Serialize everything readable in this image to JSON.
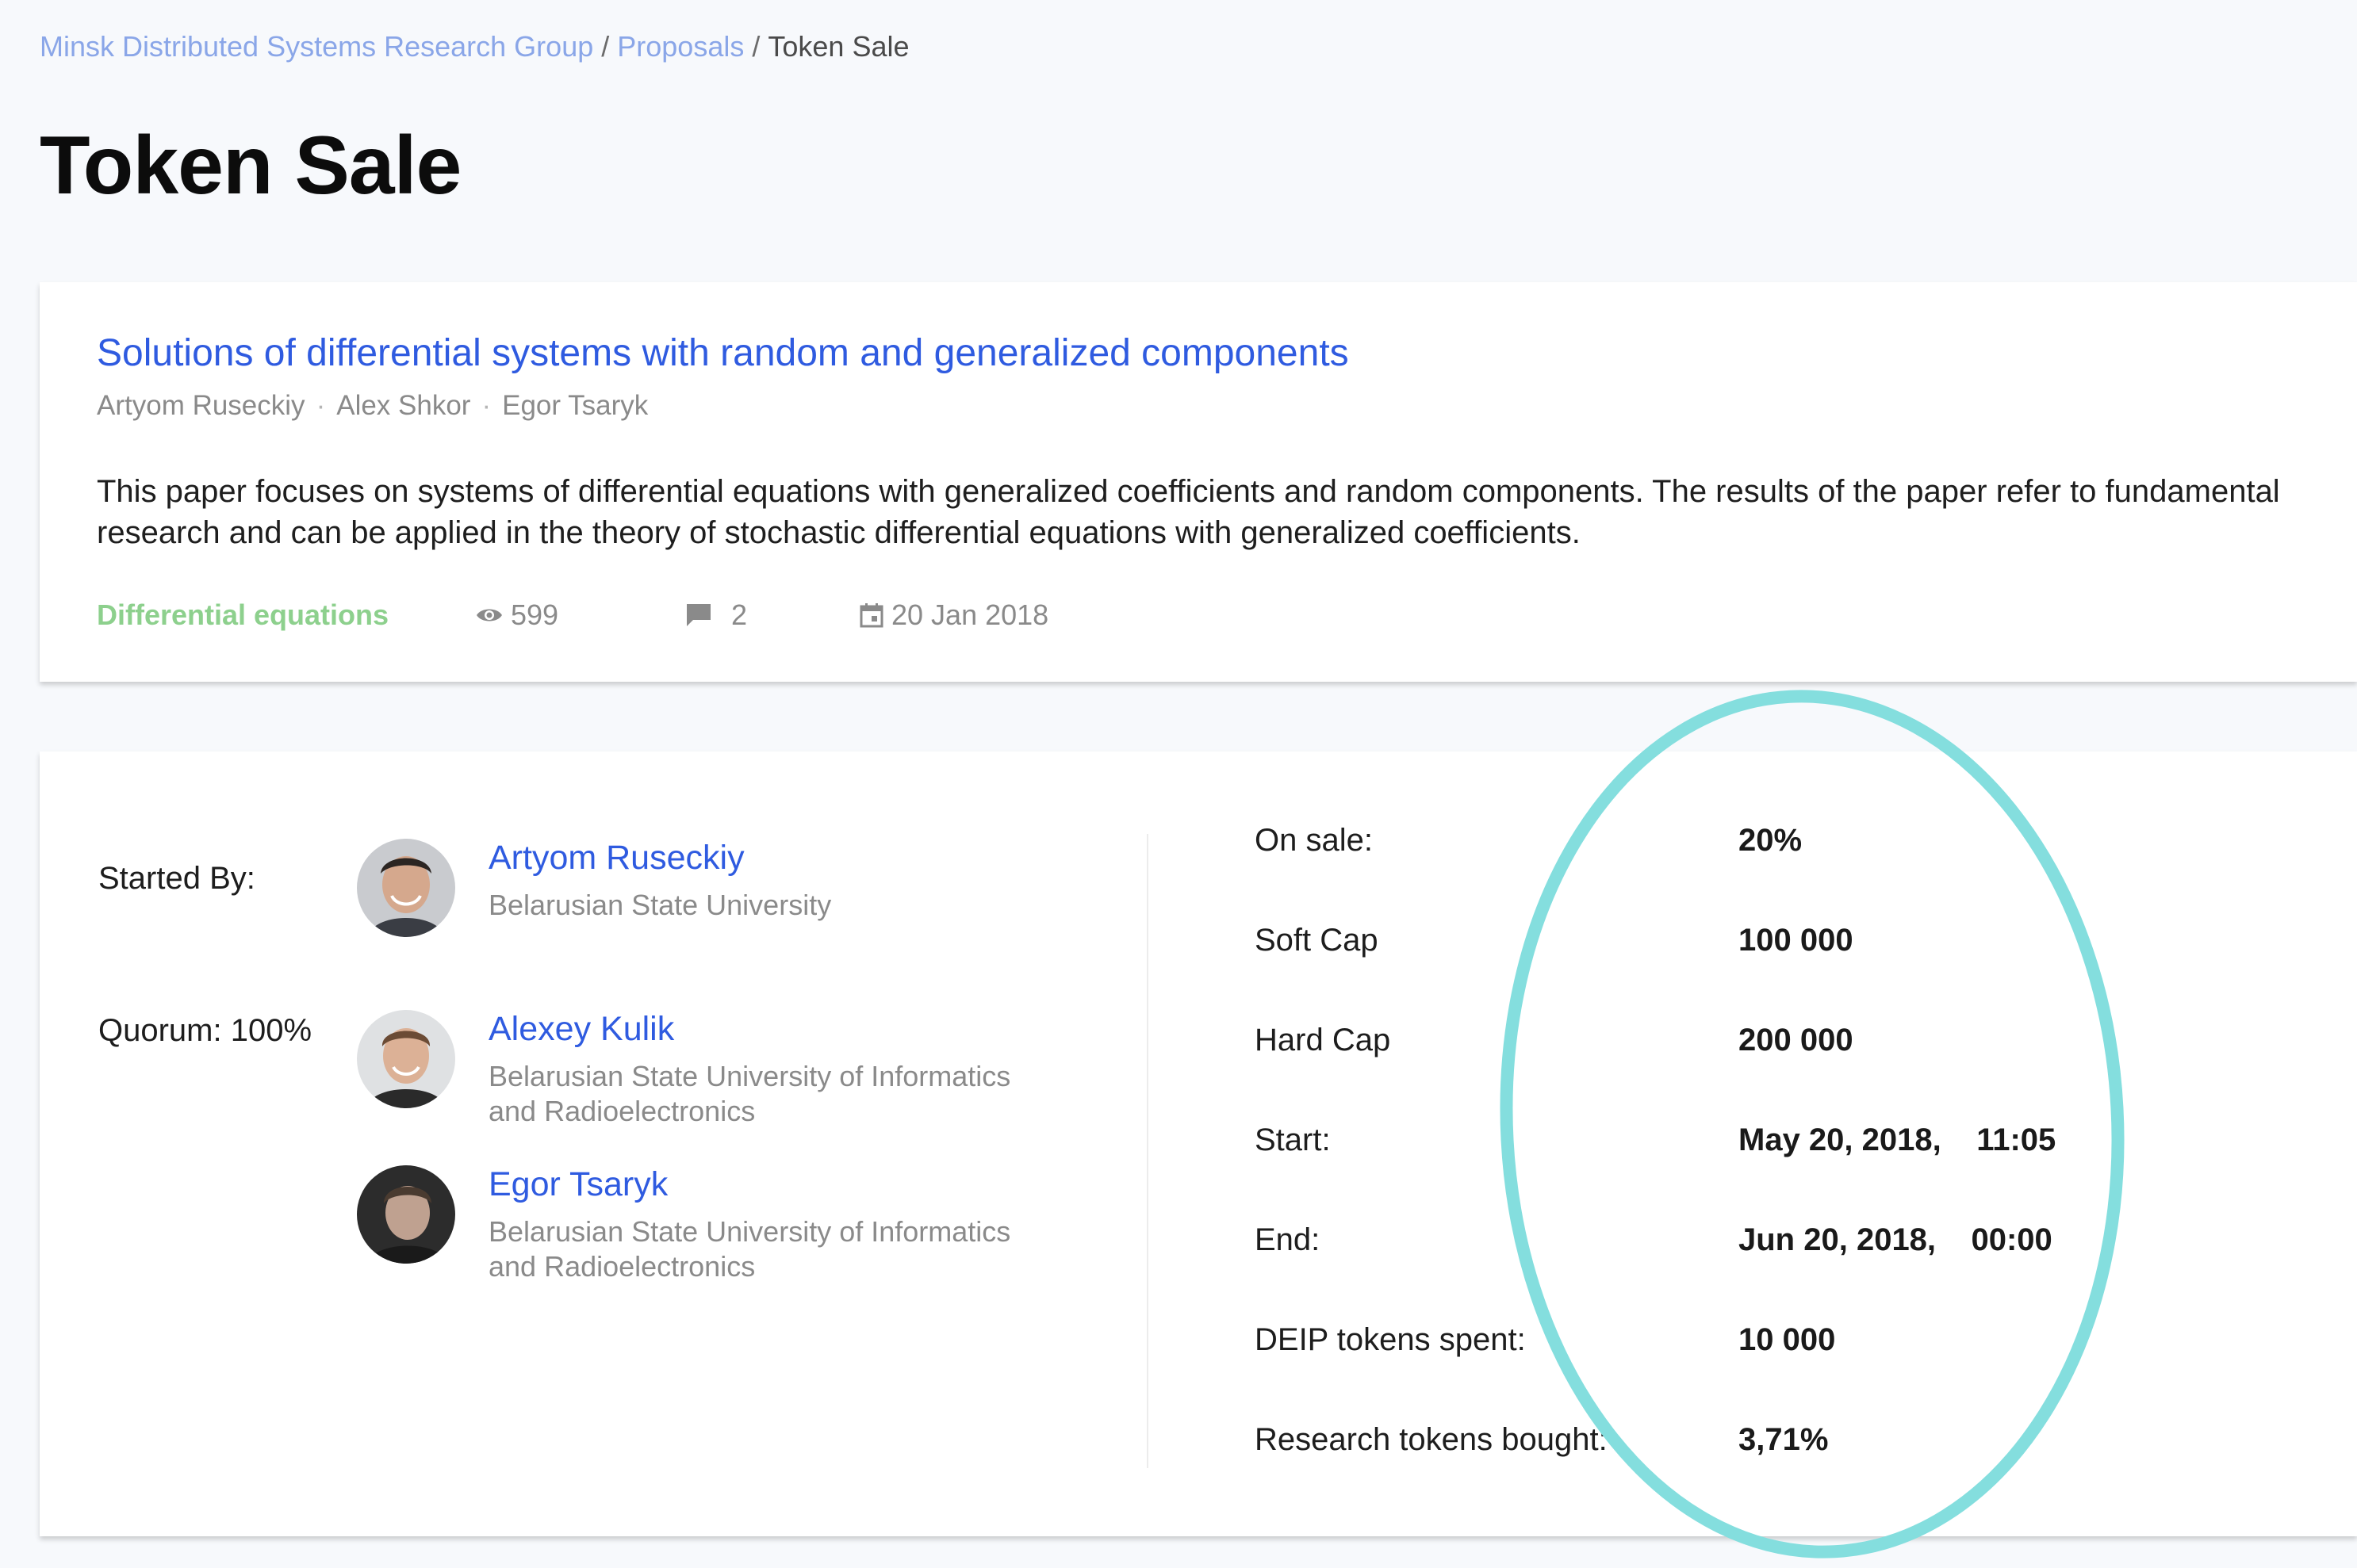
{
  "breadcrumb": {
    "group": "Minsk Distributed Systems Research Group",
    "proposals": "Proposals",
    "current": "Token Sale",
    "separator": "/"
  },
  "page_title": "Token Sale",
  "research": {
    "title": "Solutions of differential systems with random and generalized components",
    "authors": [
      "Artyom Ruseckiy",
      "Alex Shkor",
      "Egor Tsaryk"
    ],
    "author_separator": "·",
    "abstract": "This paper focuses on systems of differential equations with generalized coefficients and random components. The results of the paper refer to fundamental research and can be applied in the theory of stochastic differential equations with generalized coefficients.",
    "discipline": "Differential equations",
    "views": "599",
    "comments": "2",
    "date": "20 Jan 2018"
  },
  "proposal": {
    "started_by_label": "Started By:",
    "quorum_label": "Quorum: 100%",
    "starter": {
      "name": "Artyom Ruseckiy",
      "affiliation": "Belarusian State University"
    },
    "voters": [
      {
        "name": "Alexey Kulik",
        "affiliation": "Belarusian State University of Informatics and Radioelectronics"
      },
      {
        "name": "Egor Tsaryk",
        "affiliation": "Belarusian State University of Informatics and Radioelectronics"
      }
    ]
  },
  "token_sale": [
    {
      "label": "On sale:",
      "value": "20%"
    },
    {
      "label": "Soft Cap",
      "value": "100 000"
    },
    {
      "label": "Hard Cap",
      "value": "200 000"
    },
    {
      "label": "Start:",
      "value": "May 20, 2018,    11:05"
    },
    {
      "label": "End:",
      "value": "Jun 20, 2018,    00:00"
    },
    {
      "label": "DEIP tokens spent:",
      "value": "10 000"
    },
    {
      "label": "Research tokens bought:",
      "value": "3,71%"
    }
  ],
  "colors": {
    "link": "#2f5be0",
    "breadcrumb_link": "#8aa6e8",
    "discipline": "#8dd08d",
    "highlight": "#84dede"
  },
  "icons": {
    "views": "eye-icon",
    "comments": "comment-icon",
    "date": "calendar-icon"
  }
}
